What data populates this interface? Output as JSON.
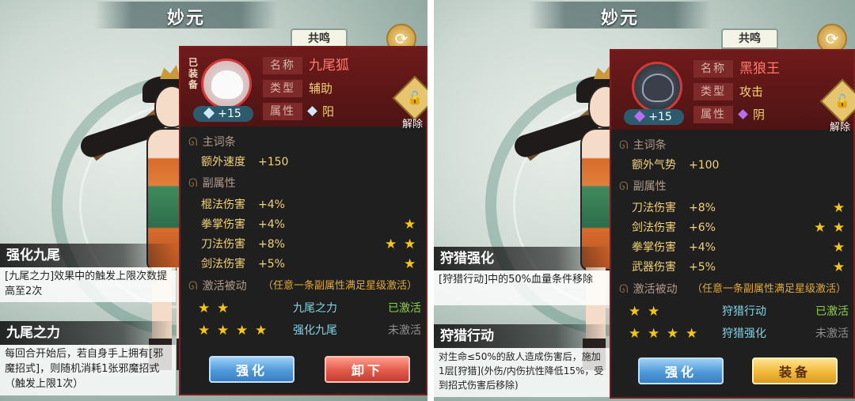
{
  "left": {
    "title": "妙元",
    "resonance_tab": "共鸣",
    "swap_icon": "swap-arrows-icon",
    "skill1": {
      "title": "强化九尾",
      "desc": "[九尾之力]效果中的触发上限次数提高至2次"
    },
    "skill2": {
      "title": "九尾之力",
      "desc": "每回合开始后，若自身手上拥有[邪魔招式]，则随机消耗1张邪魔招式（触发上限1次）"
    },
    "card": {
      "equipped_badge": "已装备",
      "level": "+15",
      "name_label": "名称",
      "name_value": "九尾狐",
      "type_label": "类型",
      "type_value": "辅助",
      "attr_label": "属性",
      "attr_value": "阳",
      "unequip_label": "解除",
      "main_stat_head": "主词条",
      "main_stat": {
        "name": "额外速度",
        "value": "+150"
      },
      "sub_stat_head": "副属性",
      "sub_stats": [
        {
          "name": "棍法伤害",
          "value": "+4%",
          "stars": 0
        },
        {
          "name": "拳掌伤害",
          "value": "+4%",
          "stars": 1
        },
        {
          "name": "刀法伤害",
          "value": "+8%",
          "stars": 2
        },
        {
          "name": "剑法伤害",
          "value": "+5%",
          "stars": 1
        }
      ],
      "passive_head": "激活被动",
      "passive_hint": "（任意一条副属性满足星级激活）",
      "passives": [
        {
          "stars": 2,
          "name": "九尾之力",
          "status": "已激活",
          "active": true
        },
        {
          "stars": 4,
          "name": "强化九尾",
          "status": "未激活",
          "active": false
        }
      ],
      "btn_primary": "强化",
      "btn_secondary": "卸下"
    }
  },
  "right": {
    "title": "妙元",
    "resonance_tab": "共鸣",
    "swap_icon": "swap-arrows-icon",
    "skill1": {
      "title": "狩猎强化",
      "desc": "[狩猎行动]中的50%血量条件移除"
    },
    "skill2": {
      "title": "狩猎行动",
      "desc": "对生命≤50%的敌人造成伤害后，施加1层[狩猎](外伤/内伤抗性降低15%，受到招式伤害后移除)"
    },
    "card": {
      "level": "+15",
      "name_label": "名称",
      "name_value": "黑狼王",
      "type_label": "类型",
      "type_value": "攻击",
      "attr_label": "属性",
      "attr_value": "阴",
      "unequip_label": "解除",
      "main_stat_head": "主词条",
      "main_stat": {
        "name": "额外气势",
        "value": "+100"
      },
      "sub_stat_head": "副属性",
      "sub_stats": [
        {
          "name": "刀法伤害",
          "value": "+8%",
          "stars": 1
        },
        {
          "name": "剑法伤害",
          "value": "+6%",
          "stars": 2
        },
        {
          "name": "拳掌伤害",
          "value": "+4%",
          "stars": 1
        },
        {
          "name": "武器伤害",
          "value": "+5%",
          "stars": 1
        }
      ],
      "passive_head": "激活被动",
      "passive_hint": "（任意一条副属性满足星级激活）",
      "passives": [
        {
          "stars": 2,
          "name": "狩猎行动",
          "status": "已激活",
          "active": true
        },
        {
          "stars": 4,
          "name": "狩猎强化",
          "status": "未激活",
          "active": false
        }
      ],
      "btn_primary": "强化",
      "btn_secondary": "装备"
    }
  },
  "colors": {
    "card_border": "#7a1f1f",
    "gold_text": "#f3d27a",
    "cyan_text": "#7fd6e8",
    "active_green": "#8bd04a",
    "star": "#f5c518"
  }
}
